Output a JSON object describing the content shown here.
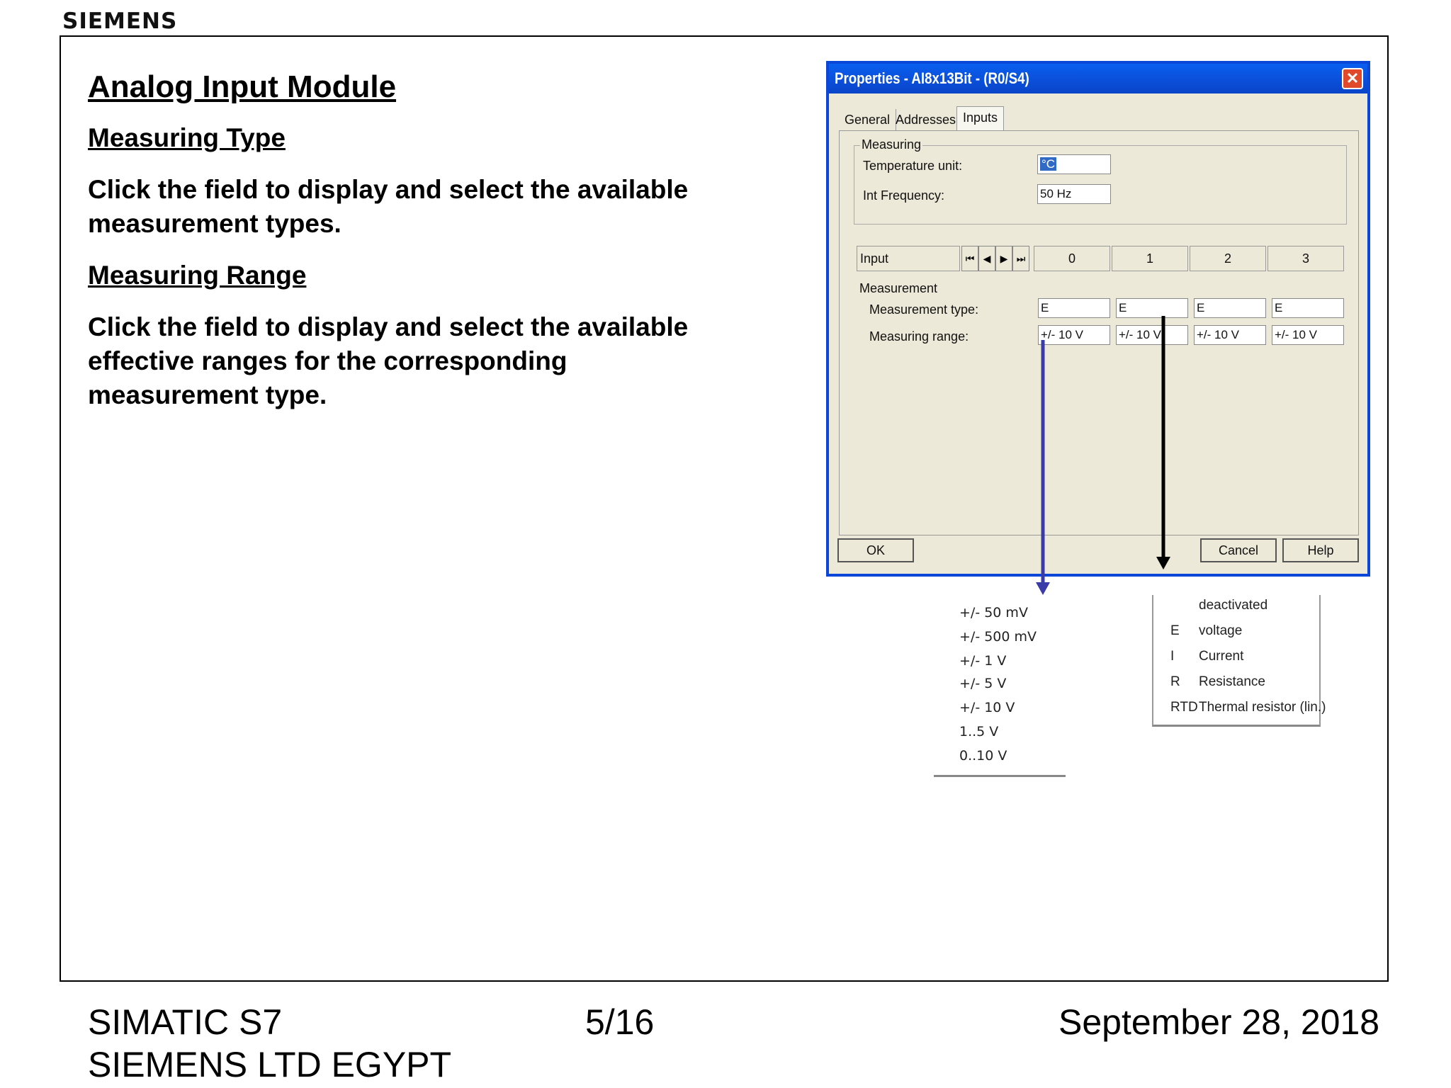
{
  "brand": "SIEMENS",
  "slide": {
    "title": "Analog Input Module",
    "section1_heading": "Measuring Type",
    "section1_text_line1": "Click the field to display and select the available",
    "section1_text_line2": "measurement types.",
    "section2_heading": "Measuring Range",
    "section2_text_line1": "Click the field to display and select the available",
    "section2_text_line2": "effective ranges for the corresponding",
    "section2_text_line3": "measurement type."
  },
  "dialog": {
    "title": "Properties - AI8x13Bit - (R0/S4)",
    "close_glyph": "✕",
    "tabs": [
      "General",
      "Addresses",
      "Inputs"
    ],
    "measuring_group": "Measuring",
    "temperature_unit_label": "Temperature unit:",
    "temperature_unit_value": "°C",
    "int_frequency_label": "Int Frequency:",
    "int_frequency_value": "50 Hz",
    "input_label": "Input",
    "nav": {
      "first": "⏮",
      "prev": "◀",
      "next": "▶",
      "last": "⏭"
    },
    "channels": [
      "0",
      "1",
      "2",
      "3"
    ],
    "measurement_label": "Measurement",
    "measurement_type_label": "Measurement type:",
    "measurement_types": [
      "E",
      "E",
      "E",
      "E"
    ],
    "measuring_range_label": "Measuring range:",
    "measuring_ranges": [
      "+/- 10 V",
      "+/- 10 V",
      "+/- 10 V",
      "+/- 10 V"
    ],
    "ok_label": "OK",
    "cancel_label": "Cancel",
    "help_label": "Help"
  },
  "range_options": [
    "+/- 50 mV",
    "+/- 500 mV",
    "+/- 1 V",
    "+/- 5 V",
    "+/- 10 V",
    "1..5 V",
    "0..10 V"
  ],
  "type_options": [
    {
      "code": "",
      "name": "deactivated"
    },
    {
      "code": "E",
      "name": "voltage"
    },
    {
      "code": "I",
      "name": "Current"
    },
    {
      "code": "R",
      "name": "Resistance"
    },
    {
      "code": "RTD",
      "name": "Thermal resistor (lin.)"
    }
  ],
  "arrow_colors": {
    "range": "#3a3aa8",
    "type": "#000000"
  },
  "footer": {
    "product": "SIMATIC S7",
    "company": "SIEMENS LTD EGYPT",
    "page": "5/16",
    "date": "September 28, 2018"
  }
}
